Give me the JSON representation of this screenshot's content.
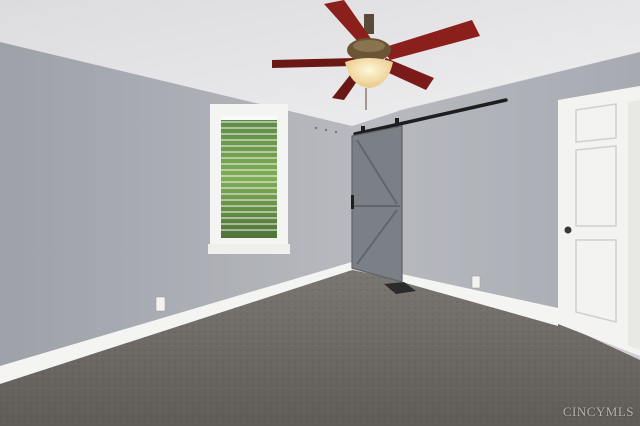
{
  "photo": {
    "watermark": "CINCYMLS"
  },
  "colors": {
    "wall_left": "#a9abb3",
    "wall_back": "#b4b6bd",
    "ceiling": "#e6e6e8",
    "carpet": "#6e6a66",
    "trim": "#f4f4f2",
    "barn_door": "#7b8087",
    "fan_blade": "#8a1f1c"
  }
}
